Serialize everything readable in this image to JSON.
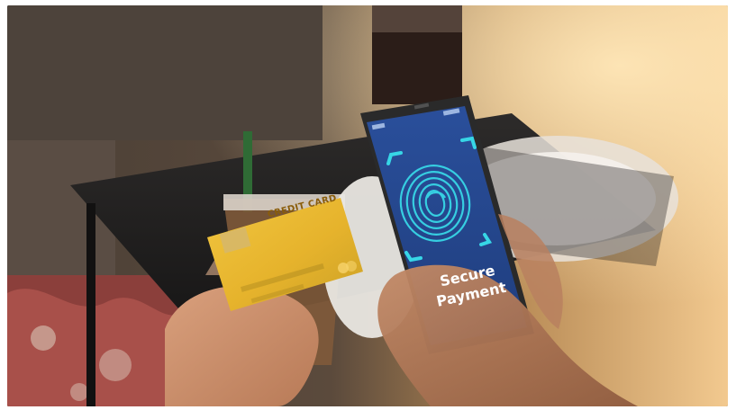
{
  "photo": {
    "subject": "hands holding a credit card and a smartphone with fingerprint scan",
    "card": {
      "label": "CREDIT CARD",
      "color": "#e7b62a"
    },
    "phone": {
      "screen_color": "#2c4f9c",
      "title_line_1": "Secure",
      "title_line_2": "Payment",
      "icon": "fingerprint-icon"
    }
  }
}
